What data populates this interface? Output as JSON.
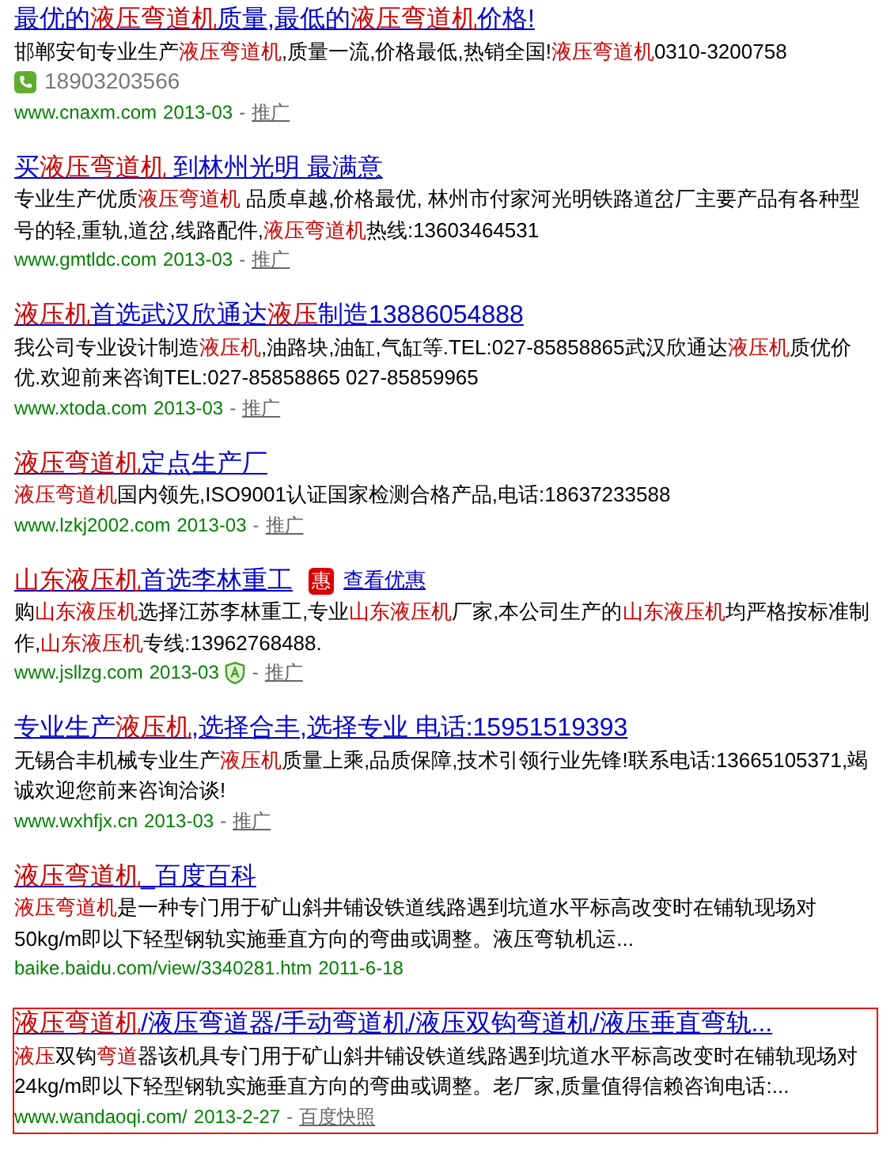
{
  "results": [
    {
      "title": "最优的**液压弯道机**质量,最低的**液压弯道机**价格!",
      "description": "邯郸安旬专业生产**液压弯道机**,质量一流,价格最低,热销全国!**液压弯道机**0310-3200758",
      "phone": "18903203566",
      "url": "www.cnaxm.com",
      "date": "2013-03",
      "verified": false,
      "sep": "-",
      "link": "推广",
      "highlighted": false
    },
    {
      "title": "买**液压弯道机** 到林州光明 最满意",
      "description": "专业生产优质**液压弯道机** 品质卓越,价格最优, 林州市付家河光明铁路道岔厂主要产品有各种型号的轻,重轨,道岔,线路配件,**液压弯道机**热线:13603464531",
      "url": "www.gmtldc.com",
      "date": "2013-03",
      "verified": false,
      "sep": "-",
      "link": "推广",
      "highlighted": false
    },
    {
      "title": "**液压机**首选武汉欣通达**液压**制造13886054888",
      "description": "我公司专业设计制造**液压机**,油路块,油缸,气缸等.TEL:027-85858865武汉欣通达**液压机**质优价优.欢迎前来咨询TEL:027-85858865 027-85859965",
      "url": "www.xtoda.com",
      "date": "2013-03",
      "verified": false,
      "sep": "-",
      "link": "推广",
      "highlighted": false
    },
    {
      "title": "**液压弯道机**定点生产厂",
      "description": "**液压弯道机**国内领先,ISO9001认证国家检测合格产品,电话:18637233588",
      "url": "www.lzkj2002.com",
      "date": "2013-03",
      "verified": false,
      "sep": "-",
      "link": "推广",
      "highlighted": false
    },
    {
      "title": "**山东液压机**首选李林重工",
      "badge": "惠",
      "offer": "查看优惠",
      "description": "购**山东液压机**选择江苏李林重工,专业**山东液压机**厂家,本公司生产的**山东液压机**均严格按标准制作,**山东液压机**专线:13962768488.",
      "url": "www.jsllzg.com",
      "date": "2013-03",
      "verified": true,
      "sep": "-",
      "link": "推广",
      "highlighted": false
    },
    {
      "title": "专业生产**液压机**,选择合丰,选择专业 电话:15951519393",
      "description": "无锡合丰机械专业生产**液压机**质量上乘,品质保障,技术引领行业先锋!联系电话:13665105371,竭诚欢迎您前来咨询洽谈!",
      "url": "www.wxhfjx.cn",
      "date": "2013-03",
      "verified": false,
      "sep": "-",
      "link": "推广",
      "highlighted": false
    },
    {
      "title": "**液压弯道机**_百度百科",
      "description": "**液压弯道机**是一种专门用于矿山斜井铺设铁道线路遇到坑道水平标高改变时在铺轨现场对50kg/m即以下轻型钢轨实施垂直方向的弯曲或调整。液压弯轨机运...",
      "url": "baike.baidu.com/view/3340281.htm",
      "date": "2011-6-18",
      "verified": false,
      "highlighted": false
    },
    {
      "title": "**液压弯道机**/液压弯道器/手动弯道机/液压双钩弯道机/液压垂直弯轨...",
      "description": "**液压**双钩**弯道**器该机具专门用于矿山斜井铺设铁道线路遇到坑道水平标高改变时在铺轨现场对24kg/m即以下轻型钢轨实施垂直方向的弯曲或调整。老厂家,质量值得信赖咨询电话:...",
      "url": "www.wandaoqi.com/",
      "date": "2013-2-27",
      "verified": false,
      "sep": "-",
      "link": "百度快照",
      "highlighted": true
    }
  ]
}
